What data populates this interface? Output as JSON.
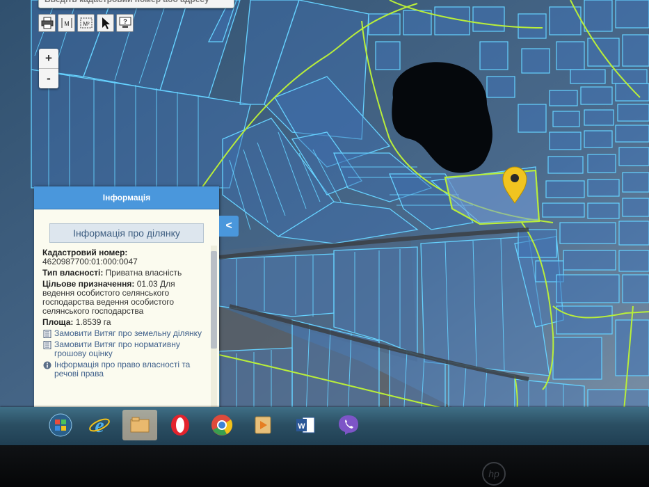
{
  "search": {
    "placeholder": "Введіть кадастровий номер або адресу"
  },
  "toolbar": {
    "tools": [
      {
        "name": "print-icon"
      },
      {
        "name": "measure-distance-icon",
        "text": "M"
      },
      {
        "name": "measure-area-icon",
        "text": "M²"
      },
      {
        "name": "pointer-icon"
      },
      {
        "name": "help-icon",
        "text": "?"
      }
    ]
  },
  "zoom": {
    "in": "+",
    "out": "-"
  },
  "panel": {
    "header": "Інформація",
    "subtitle": "Інформація про ділянку",
    "cadastral_label": "Кадастровий номер:",
    "cadastral_value": "4620987700:01:000:0047",
    "ownership_label": "Тип власності:",
    "ownership_value": "Приватна власність",
    "purpose_label": "Цільове призначення:",
    "purpose_value": "01.03 Для ведення особистого селянського господарства ведення особистого селянського господарства",
    "area_label": "Площа:",
    "area_value": "1.8539 га",
    "links": [
      "Замовити Витяг про земельну ділянку",
      "Замовити Витяг про нормативну грошову оцінку",
      "Інформація про право власності та речові права"
    ],
    "collapse": "<"
  },
  "taskbar": {
    "items": [
      "start-button",
      "internet-explorer-icon",
      "file-explorer-icon",
      "opera-icon",
      "chrome-icon",
      "media-player-icon",
      "word-icon",
      "viber-icon"
    ]
  },
  "colors": {
    "parcel": "#66d2ff",
    "boundary": "#b9ee3a",
    "marker": "#f1c420",
    "panel_header": "#4a97dc"
  }
}
